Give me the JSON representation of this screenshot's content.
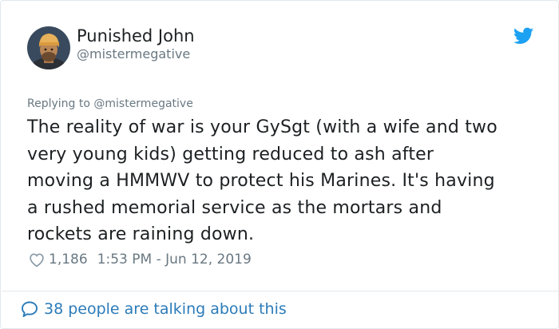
{
  "tweet": {
    "author": {
      "display_name": "Punished John",
      "handle": "@mistermegative"
    },
    "replying_to": "Replying to @mistermegative",
    "text_lines": [
      "The reality of war is your GySgt (with a wife and two",
      "very young kids) getting reduced to ash after",
      "moving a HMMWV to protect his Marines. It's having",
      "a rushed memorial service as the mortars and",
      "rockets are raining down."
    ],
    "likes": "1,186",
    "timestamp": "1:53 PM - Jun 12, 2019",
    "footer_text": "38 people are talking about this"
  },
  "icons": {
    "brand": "twitter-bird-icon",
    "like": "heart-icon",
    "conversation": "speech-bubble-icon"
  },
  "colors": {
    "brand_blue": "#1da1f2",
    "link_blue": "#2b7bb9",
    "secondary_text": "#697882",
    "primary_text": "#1c2022",
    "border": "#e1e8ed"
  }
}
